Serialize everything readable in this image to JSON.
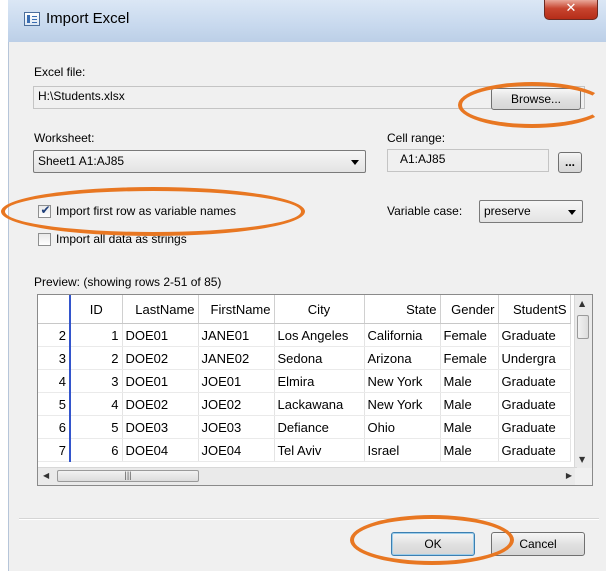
{
  "window": {
    "title": "Import Excel",
    "close_glyph": "✕"
  },
  "excel_file": {
    "label": "Excel file:",
    "value": "H:\\Students.xlsx",
    "browse_label": "Browse..."
  },
  "worksheet": {
    "label": "Worksheet:",
    "selected": "Sheet1 A1:AJ85"
  },
  "cell_range": {
    "label": "Cell range:",
    "value": "A1:AJ85",
    "button_label": "..."
  },
  "options": {
    "first_row_label": "Import first row as variable names",
    "first_row_checked": true,
    "all_strings_label": "Import all data as strings",
    "all_strings_checked": false,
    "variable_case_label": "Variable case:",
    "variable_case_value": "preserve"
  },
  "preview": {
    "label": "Preview: (showing rows 2-51 of 85)",
    "columns": [
      "",
      "ID",
      "LastName",
      "FirstName",
      "City",
      "State",
      "Gender",
      "StudentS"
    ],
    "rows": [
      [
        "2",
        "1",
        "DOE01",
        "JANE01",
        "Los Angeles",
        "California",
        "Female",
        "Graduate"
      ],
      [
        "3",
        "2",
        "DOE02",
        "JANE02",
        "Sedona",
        "Arizona",
        "Female",
        "Undergra"
      ],
      [
        "4",
        "3",
        "DOE01",
        "JOE01",
        "Elmira",
        "New York",
        "Male",
        "Graduate"
      ],
      [
        "5",
        "4",
        "DOE02",
        "JOE02",
        "Lackawana",
        "New York",
        "Male",
        "Graduate"
      ],
      [
        "6",
        "5",
        "DOE03",
        "JOE03",
        "Defiance",
        "Ohio",
        "Male",
        "Graduate"
      ],
      [
        "7",
        "6",
        "DOE04",
        "JOE04",
        "Tel Aviv",
        "Israel",
        "Male",
        "Graduate"
      ]
    ]
  },
  "buttons": {
    "ok": "OK",
    "cancel": "Cancel"
  },
  "colors": {
    "highlight_oval": "#e87722",
    "close_button": "#c7442f",
    "row_divider": "#3355cc"
  }
}
